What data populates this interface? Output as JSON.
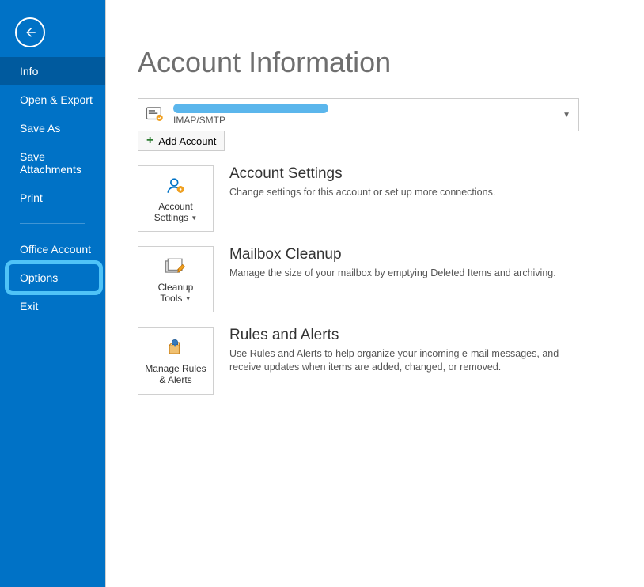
{
  "sidebar": {
    "items": [
      {
        "label": "Info",
        "active": true
      },
      {
        "label": "Open & Export"
      },
      {
        "label": "Save As"
      },
      {
        "label": "Save Attachments"
      },
      {
        "label": "Print"
      },
      {
        "divider": true
      },
      {
        "label": "Office Account"
      },
      {
        "label": "Options",
        "highlighted": true
      },
      {
        "label": "Exit"
      }
    ]
  },
  "page": {
    "title": "Account Information"
  },
  "account": {
    "type": "IMAP/SMTP",
    "add_label": "Add Account"
  },
  "sections": {
    "settings": {
      "btn_line1": "Account",
      "btn_line2": "Settings",
      "title": "Account Settings",
      "desc": "Change settings for this account or set up more connections."
    },
    "cleanup": {
      "btn_line1": "Cleanup",
      "btn_line2": "Tools",
      "title": "Mailbox Cleanup",
      "desc": "Manage the size of your mailbox by emptying Deleted Items and archiving."
    },
    "rules": {
      "btn_line1": "Manage Rules",
      "btn_line2": "& Alerts",
      "title": "Rules and Alerts",
      "desc": "Use Rules and Alerts to help organize your incoming e-mail messages, and receive updates when items are added, changed, or removed."
    }
  }
}
